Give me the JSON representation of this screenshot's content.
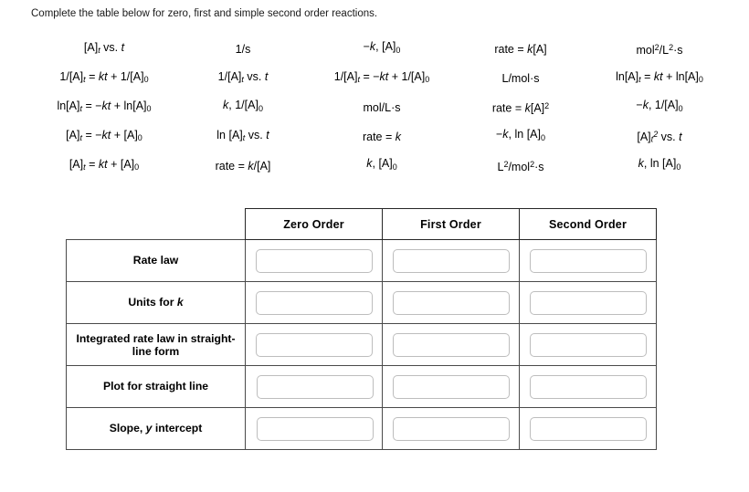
{
  "prompt": "Complete the table below for zero, first and simple second order reactions.",
  "answer_bank": {
    "rows": [
      [
        "[A]_t vs. t",
        "1/s",
        "−k, [A]₀",
        "rate = k[A]",
        "mol²/L²·s"
      ],
      [
        "1/[A]_t = kt + 1/[A]₀",
        "1/[A]_t vs. t",
        "1/[A]_t = −kt + 1/[A]₀",
        "L/mol·s",
        "ln[A]_t = kt + ln[A]₀"
      ],
      [
        "ln[A]_t = −kt + ln[A]₀",
        "k, 1/[A]₀",
        "mol/L·s",
        "rate = k[A]²",
        "−k, 1/[A]₀"
      ],
      [
        "[A]_t = −kt + [A]₀",
        "ln [A]_t vs. t",
        "rate = k",
        "−k, ln [A]₀",
        "[A]_t² vs. t"
      ],
      [
        "[A]_t = kt + [A]₀",
        "rate = k/[A]",
        "k, [A]₀",
        "L²/mol²·s",
        "k, ln [A]₀"
      ]
    ]
  },
  "table": {
    "headers": [
      "",
      "Zero Order",
      "First Order",
      "Second Order"
    ],
    "row_labels": [
      "Rate law",
      "Units for k",
      "Integrated rate law in straight-line form",
      "Plot for straight line",
      "Slope, y intercept"
    ],
    "cell_values": [
      [
        "",
        "",
        ""
      ],
      [
        "",
        "",
        ""
      ],
      [
        "",
        "",
        ""
      ],
      [
        "",
        "",
        ""
      ],
      [
        "",
        "",
        ""
      ]
    ],
    "input_placeholder": ""
  },
  "colors": {
    "page_background": "#ffffff",
    "text": "#000000",
    "header_border": "#262626",
    "cell_border": "#4a4a4a",
    "input_border": "#bdbdbd"
  }
}
